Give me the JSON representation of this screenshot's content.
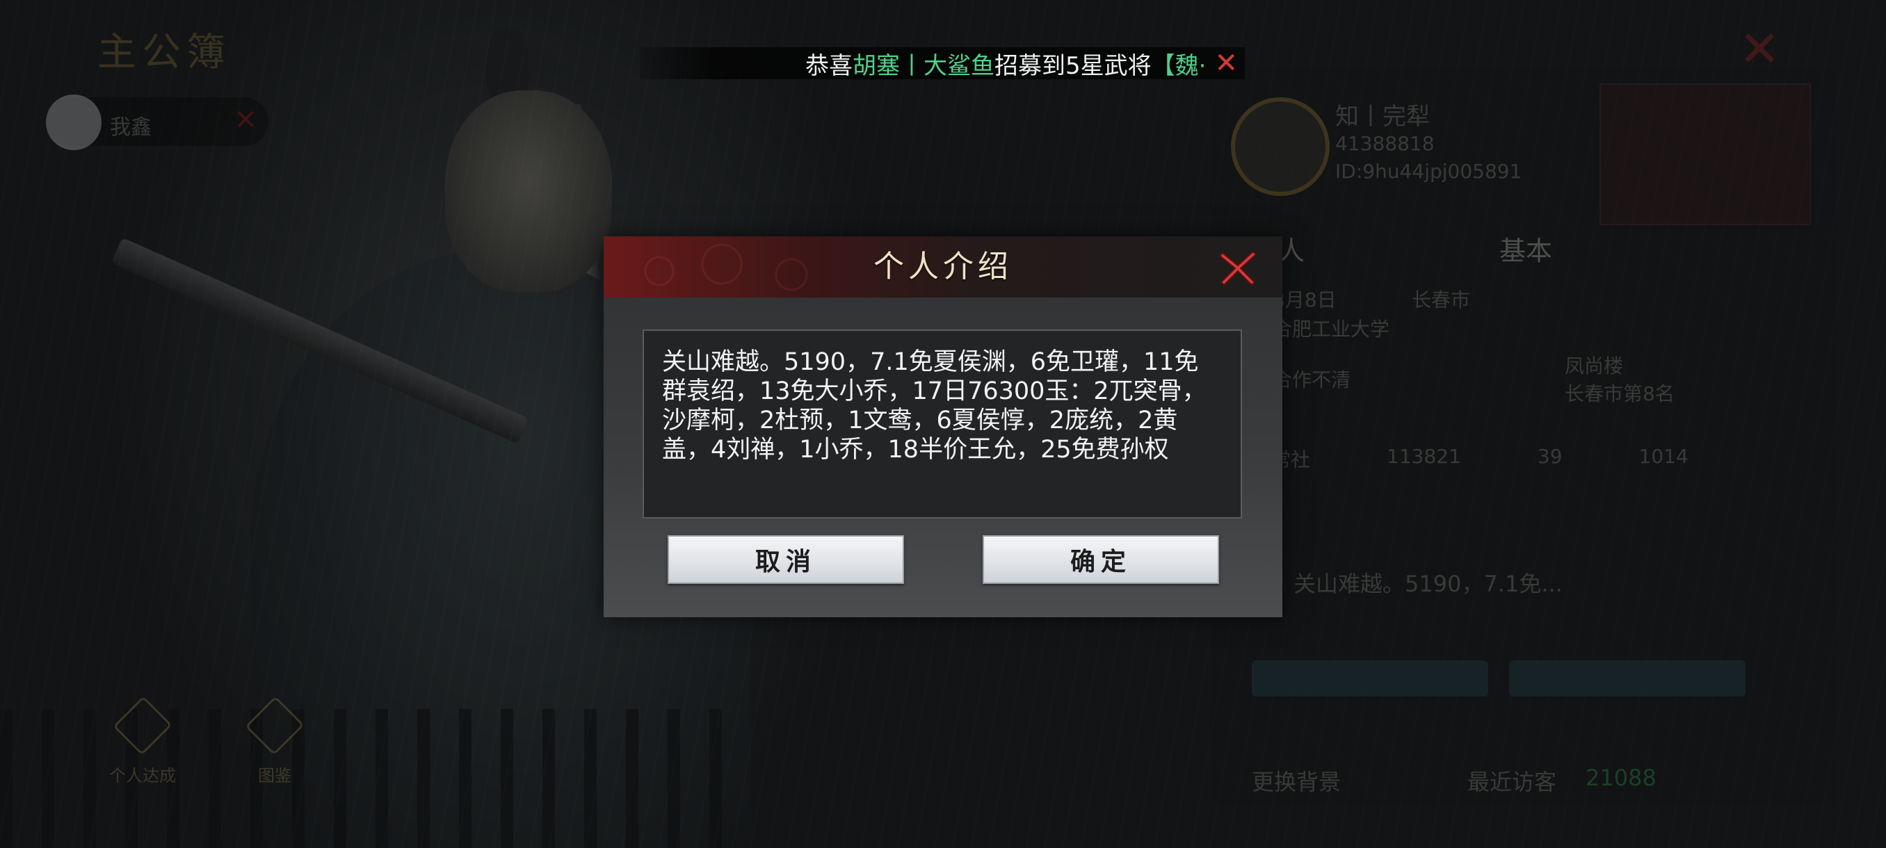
{
  "background": {
    "brand_title": "主公簿",
    "user_name": "我鑫",
    "bottom_icons": [
      {
        "label": "个人达成",
        "icon": "achievement-icon"
      },
      {
        "label": "图鉴",
        "icon": "codex-icon"
      }
    ],
    "profile": {
      "name": "知丨完犁",
      "uid": "41388818",
      "id_line": "ID:9hu44jpj005891",
      "tabs": [
        "个人",
        "基本"
      ],
      "birthday": "8月8日",
      "city": "长春市",
      "school": "合肥工业大学",
      "tag_left": "合作不清",
      "tag_right": "凤尚楼",
      "tag_right_sub": "长春市第8名",
      "stats": [
        "日常社",
        "113821",
        "39",
        "1014"
      ],
      "intro_preview": "关山难越。5190，7.1免...",
      "recent_visit_label": "最近访客",
      "recent_visit_count": "21088",
      "change_bg_label": "更换背景"
    }
  },
  "notice": {
    "prefix": "恭喜",
    "name1": "胡塞",
    "sep": "丨",
    "name2": "大鲨鱼",
    "mid": "招募到5星武将",
    "tail": "【魏·"
  },
  "dialog": {
    "title": "个人介绍",
    "text": "关山难越。5190，7.1免夏侯渊，6免卫瓘，11免群袁绍，13免大小乔，17日76300玉：2兀突骨，沙摩柯，2杜预，1文鸯，6夏侯惇，2庞统，2黄盖，4刘禅，1小乔，18半价王允，25免费孙权",
    "cancel_label": "取消",
    "confirm_label": "确定"
  },
  "colors": {
    "accent_green": "#4fd08a",
    "close_red": "#d33a3a",
    "header_red": "#6a1a1a"
  }
}
